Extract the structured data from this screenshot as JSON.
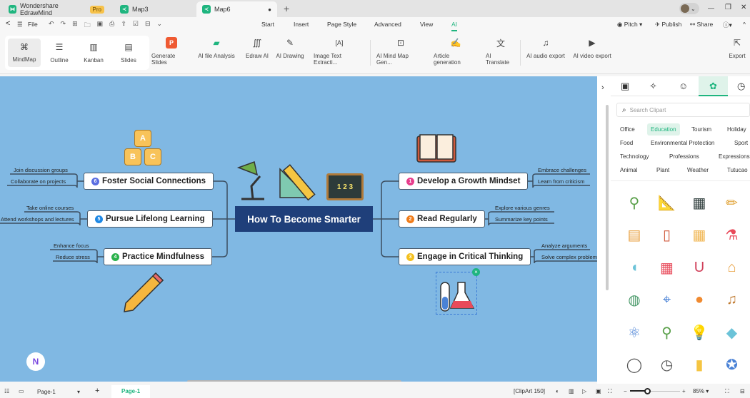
{
  "tabs": [
    {
      "label": "Wondershare EdrawMind",
      "badge": "Pro"
    },
    {
      "label": "Map3"
    },
    {
      "label": "Map6",
      "modified_dot": "●"
    }
  ],
  "tab_add": "+",
  "window": {
    "minimize": "—",
    "restore": "❐",
    "close": "✕",
    "avatar_caret": "⌄"
  },
  "menu": {
    "back": "<",
    "hamburger": "☰",
    "file": "File",
    "items": [
      "Start",
      "Insert",
      "Page Style",
      "Advanced",
      "View",
      "AI"
    ],
    "active": "AI",
    "pitch": "Pitch",
    "publish": "Publish",
    "share": "Share",
    "help": "?",
    "collapse": "^"
  },
  "quick_icons": [
    "↶",
    "↷",
    "⊞",
    "🗀",
    "▣",
    "⎙",
    "⇪",
    "☑",
    "⊟",
    "⌄"
  ],
  "views": [
    {
      "label": "MindMap",
      "icon": "⌘"
    },
    {
      "label": "Outline",
      "icon": "☰"
    },
    {
      "label": "Kanban",
      "icon": "▥"
    },
    {
      "label": "Slides",
      "icon": "▤"
    }
  ],
  "ai_tools": [
    {
      "label": "Generate Slides",
      "icon": "P"
    },
    {
      "label": "AI file Analysis",
      "icon": "▰"
    },
    {
      "label": "Edraw AI",
      "icon": "∭"
    },
    {
      "label": "AI Drawing",
      "icon": "✎"
    },
    {
      "label": "Image Text Extracti...",
      "icon": "[A]"
    },
    {
      "label": "AI Mind Map Gen...",
      "icon": "⊡"
    },
    {
      "label": "Article generation",
      "icon": "✍"
    },
    {
      "label": "AI Translate",
      "icon": "文"
    },
    {
      "label": "AI audio export",
      "icon": "♫"
    },
    {
      "label": "AI video export",
      "icon": "▶"
    },
    {
      "label": "Export",
      "icon": "⇱"
    }
  ],
  "mindmap": {
    "central": "How To Become Smarter",
    "left": [
      {
        "num": "6",
        "title": "Foster Social Connections",
        "color": "#5b6ee1",
        "leaves": [
          "Join discussion groups",
          "Collaborate on projects"
        ]
      },
      {
        "num": "5",
        "title": "Pursue Lifelong Learning",
        "color": "#1e88e5",
        "leaves": [
          "Take online courses",
          "Attend workshops and lectures"
        ]
      },
      {
        "num": "4",
        "title": "Practice Mindfulness",
        "color": "#2bb24c",
        "leaves": [
          "Enhance focus",
          "Reduce stress"
        ]
      }
    ],
    "right": [
      {
        "num": "1",
        "title": "Develop a Growth Mindset",
        "color": "#e83e8c",
        "leaves": [
          "Embrace challenges",
          "Learn from criticism"
        ]
      },
      {
        "num": "2",
        "title": "Read Regularly",
        "color": "#f07c1a",
        "leaves": [
          "Explore various genres",
          "Summarize key points"
        ]
      },
      {
        "num": "3",
        "title": "Engage in Critical Thinking",
        "color": "#f4c01e",
        "leaves": [
          "Analyze arguments",
          "Solve complex problems"
        ]
      }
    ],
    "blocks": [
      "A",
      "B",
      "C"
    ],
    "chalkboard": "1 2 3"
  },
  "panel": {
    "tabs": [
      "▣",
      "✧",
      "☺",
      "✿",
      "◷"
    ],
    "search_placeholder": "Search Clipart",
    "categories": [
      "Office",
      "Education",
      "Tourism",
      "Holiday",
      "Food",
      "Environmental Protection",
      "Sport",
      "Technology",
      "Professions",
      "Expressions",
      "Animal",
      "Plant",
      "Weather",
      "Tutucao"
    ],
    "active_category": "Education",
    "cliparts": [
      "lamp",
      "ruler",
      "chalkboard",
      "pencil",
      "backpack",
      "book",
      "blocks",
      "flask",
      "bean",
      "calculator",
      "magnet",
      "school",
      "globe",
      "telescope",
      "basketball",
      "guitar",
      "molecule",
      "magnifier",
      "bulb",
      "eraser",
      "watch",
      "stopwatch",
      "glue",
      "medal"
    ]
  },
  "status": {
    "page_select": "Page-1",
    "page_tab": "Page-1",
    "add": "+",
    "clipart_info": "[ClipArt 150]",
    "zoom": "85%",
    "zoom_minus": "−",
    "zoom_plus": "+",
    "zoom_level_pct": 85
  },
  "colors": {
    "accent": "#1fb57f",
    "canvas": "#80b8e3",
    "central": "#1f3f7a"
  }
}
